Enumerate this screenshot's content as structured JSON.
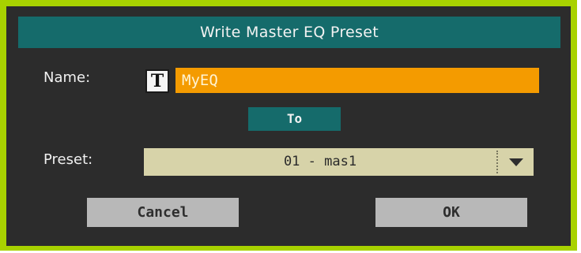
{
  "dialog": {
    "title": "Write Master EQ Preset",
    "accent_border": "#a8d200",
    "title_color": "#156b6b"
  },
  "name_row": {
    "label": "Name:",
    "text_edit_icon": "text-edit-icon",
    "text_edit_glyph": "T",
    "value": "MyEQ"
  },
  "to_label": "To",
  "preset_row": {
    "label": "Preset:",
    "selected": "01 - mas1",
    "dropdown_icon": "triangle-down-icon"
  },
  "buttons": {
    "cancel": "Cancel",
    "ok": "OK"
  }
}
